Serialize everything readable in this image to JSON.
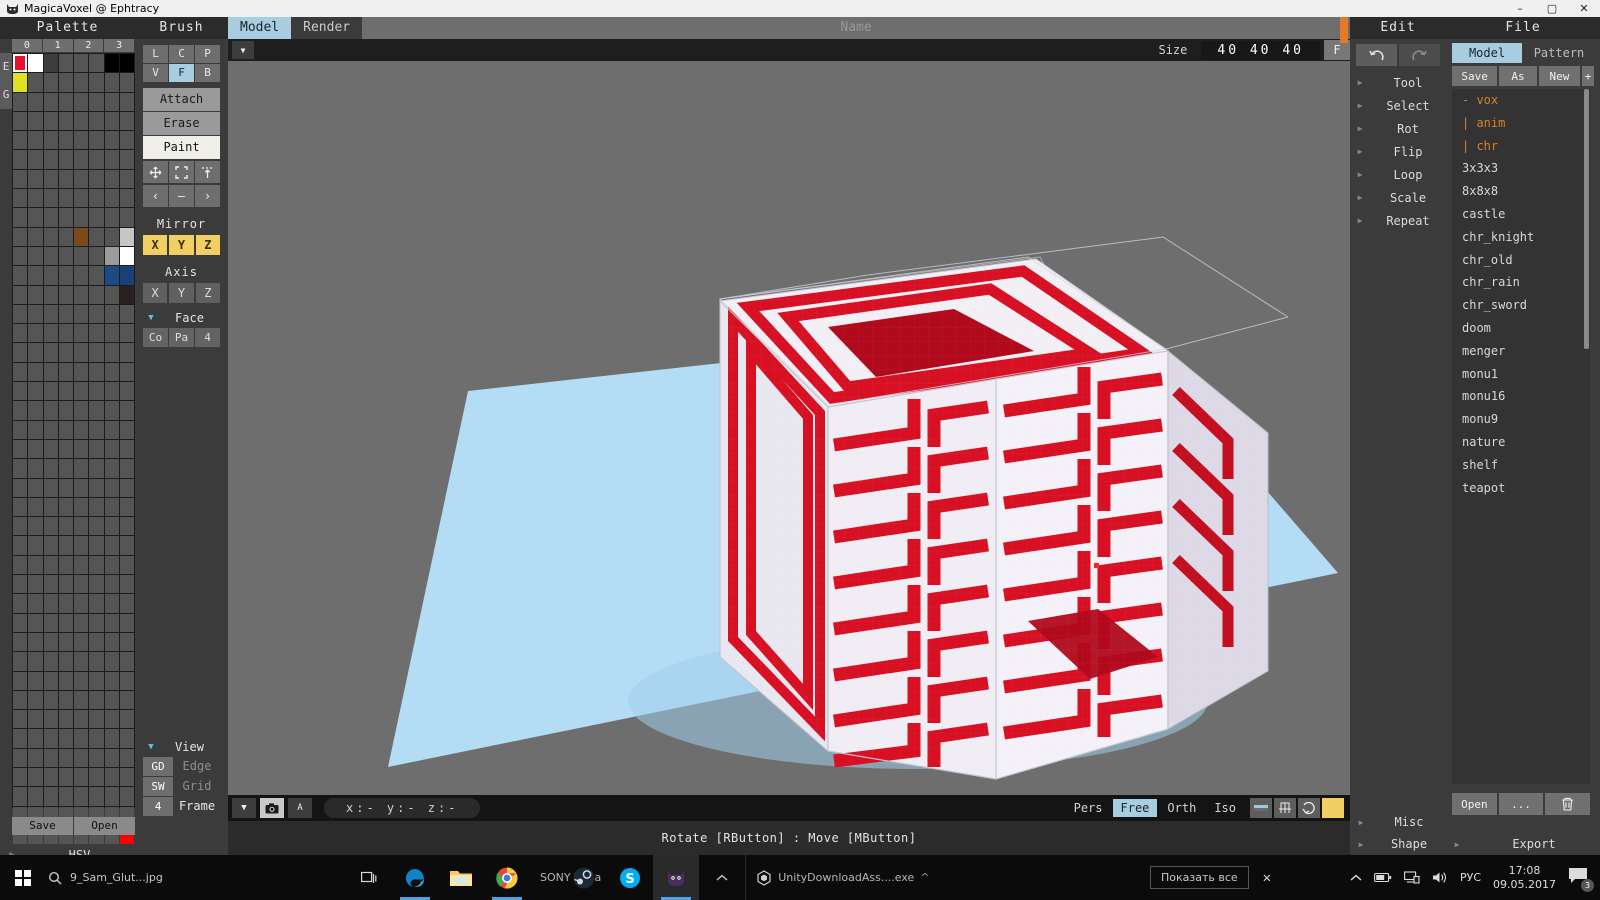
{
  "window": {
    "title": "MagicaVoxel @ Ephtracy",
    "icon": "cat-icon",
    "minimize": "–",
    "maximize": "▢",
    "close": "✕"
  },
  "palette": {
    "header": "Palette",
    "columns": [
      "0",
      "1",
      "2",
      "3"
    ],
    "side_labels": [
      "E",
      "G"
    ],
    "save_label": "Save",
    "open_label": "Open",
    "hsv_label": "HSV",
    "selected_index": 0,
    "swatches": [
      {
        "i": 0,
        "color": "#e8112d"
      },
      {
        "i": 1,
        "color": "#ffffff"
      },
      {
        "i": 2,
        "color": "#3d3d3d"
      },
      {
        "i": 6,
        "color": "#000000"
      },
      {
        "i": 7,
        "color": "#000000"
      },
      {
        "i": 8,
        "color": "#e0e028"
      },
      {
        "i": 76,
        "color": "#7a4a1c"
      },
      {
        "i": 79,
        "color": "#c6c6c6"
      },
      {
        "i": 86,
        "color": "#9c9c9c"
      },
      {
        "i": 87,
        "color": "#ffffff"
      },
      {
        "i": 94,
        "color": "#1c4a85"
      },
      {
        "i": 95,
        "color": "#1c3f78"
      },
      {
        "i": 103,
        "color": "#2a2020"
      },
      {
        "i": 327,
        "color": "#ff0000"
      }
    ]
  },
  "brush": {
    "header": "Brush",
    "shape_row": [
      "L",
      "C",
      "P"
    ],
    "mode_row": [
      "V",
      "F",
      "B"
    ],
    "mode_row_active": "F",
    "modes": [
      "Attach",
      "Erase",
      "Paint"
    ],
    "active_mode": "Paint",
    "tool_icons": [
      "move-icon",
      "frame-icon",
      "extrude-icon"
    ],
    "nav_icons": [
      "prev-icon",
      "minus-icon",
      "next-icon"
    ],
    "mirror_label": "Mirror",
    "mirror_axes": [
      "X",
      "Y",
      "Z"
    ],
    "axis_label": "Axis",
    "axis_values": [
      "X",
      "Y",
      "Z"
    ],
    "face_label": "Face",
    "face_buttons": [
      "Co",
      "Pa",
      "4"
    ],
    "view_label": "View",
    "view_rows": [
      {
        "key": "GD",
        "value": "Edge",
        "key_lit": true,
        "value_lit": false
      },
      {
        "key": "SW",
        "value": "Grid",
        "key_lit": true,
        "value_lit": false
      },
      {
        "key": "4",
        "value": "Frame",
        "key_lit": true,
        "value_lit": true
      }
    ]
  },
  "viewport": {
    "tabs": [
      {
        "label": "Model",
        "active": true
      },
      {
        "label": "Render",
        "active": false
      }
    ],
    "name_placeholder": "Name",
    "size_label": "Size",
    "size_value": "40 40 40",
    "frame_button": "F",
    "dropdown_icon": "chevron-down-icon",
    "camera_icon": "camera-icon",
    "text_icon": "A",
    "coords": "x:-    y:-    z:-",
    "projections": [
      {
        "label": "Pers",
        "active": false
      },
      {
        "label": "Free",
        "active": true
      },
      {
        "label": "Orth",
        "active": false
      },
      {
        "label": "Iso",
        "active": false
      }
    ],
    "view_icons": [
      "shade-icon",
      "grid-icon",
      "rotate-icon",
      "light-icon"
    ],
    "status_text": "Rotate [RButton] : Move [MButton]"
  },
  "edit": {
    "header": "Edit",
    "undo_icon": "undo-icon",
    "redo_icon": "redo-icon",
    "items": [
      "Tool",
      "Select",
      "Rot",
      "Flip",
      "Loop",
      "Scale",
      "Repeat"
    ],
    "bottom_items": [
      "Misc",
      "Shape"
    ]
  },
  "file": {
    "header": "File",
    "tabs": [
      {
        "label": "Model",
        "active": true
      },
      {
        "label": "Pattern",
        "active": false
      }
    ],
    "buttons": [
      "Save",
      "As",
      "New",
      "+"
    ],
    "entries": [
      {
        "label": "- vox",
        "group": true
      },
      {
        "label": "| anim",
        "group": true
      },
      {
        "label": "| chr",
        "group": true
      },
      {
        "label": "3x3x3",
        "group": false
      },
      {
        "label": "8x8x8",
        "group": false
      },
      {
        "label": "castle",
        "group": false
      },
      {
        "label": "chr_knight",
        "group": false
      },
      {
        "label": "chr_old",
        "group": false
      },
      {
        "label": "chr_rain",
        "group": false
      },
      {
        "label": "chr_sword",
        "group": false
      },
      {
        "label": "doom",
        "group": false
      },
      {
        "label": "menger",
        "group": false
      },
      {
        "label": "monu1",
        "group": false
      },
      {
        "label": "monu16",
        "group": false
      },
      {
        "label": "monu9",
        "group": false
      },
      {
        "label": "nature",
        "group": false
      },
      {
        "label": "shelf",
        "group": false
      },
      {
        "label": "teapot",
        "group": false
      }
    ],
    "bottom_buttons": [
      "Open",
      "...",
      "trash-icon"
    ],
    "export_label": "Export"
  },
  "taskbar": {
    "start_icon": "windows-logo-icon",
    "search_icon": "search-icon",
    "search_text": "9_Sam_Glut...jpg",
    "apps": [
      {
        "name": "task-view-icon",
        "label": ""
      },
      {
        "name": "edge-icon",
        "label": ""
      },
      {
        "name": "explorer-icon",
        "label": ""
      },
      {
        "name": "chrome-icon",
        "label": "SONY Vega"
      },
      {
        "name": "steam-icon",
        "label": ""
      },
      {
        "name": "skype-icon",
        "label": ""
      },
      {
        "name": "magicavoxel-icon",
        "label": ""
      }
    ],
    "unity_task": "UnityDownloadAss....exe",
    "show_all": "Показать все",
    "close_icon": "✕",
    "tray_icons": [
      "chevron-up-icon",
      "battery-icon",
      "network-icon",
      "volume-icon"
    ],
    "language": "РУС",
    "time": "17:08",
    "date": "09.05.2017",
    "notification_count": "3"
  },
  "colors": {
    "accent": "#a9cde0",
    "amber": "#f2cf63",
    "orange": "#e8762c",
    "voxel_red": "#d81024",
    "voxel_white": "#f2f0f5",
    "ground": "#b4dcf5"
  }
}
